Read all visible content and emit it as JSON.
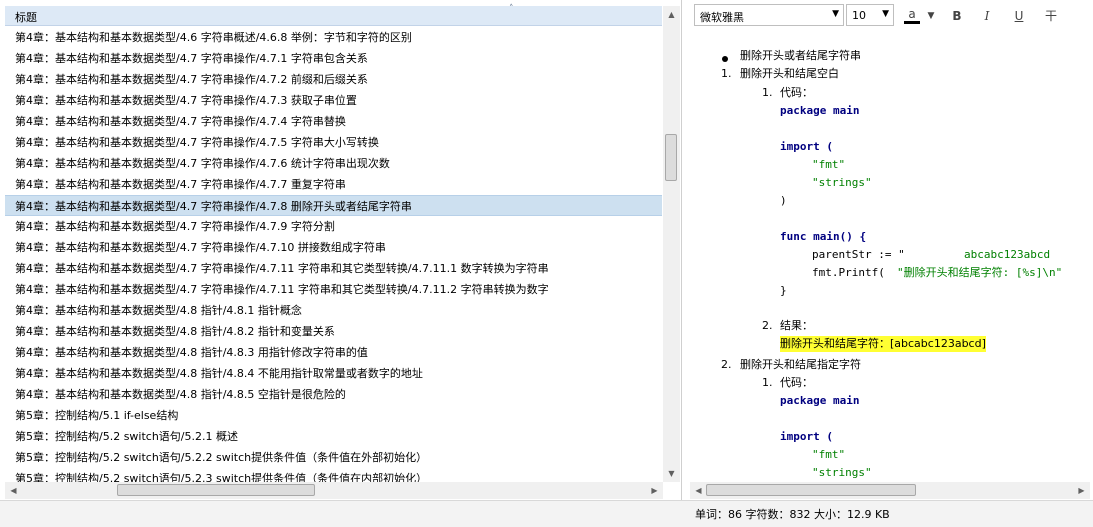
{
  "list": {
    "column_header": "标题",
    "rows": [
      "第4章：基本结构和基本数据类型/4.6 字符串概述/4.6.8 举例：字节和字符的区别",
      "第4章：基本结构和基本数据类型/4.7 字符串操作/4.7.1  字符串包含关系",
      "第4章：基本结构和基本数据类型/4.7 字符串操作/4.7.2  前缀和后缀关系",
      "第4章：基本结构和基本数据类型/4.7 字符串操作/4.7.3  获取子串位置",
      "第4章：基本结构和基本数据类型/4.7 字符串操作/4.7.4  字符串替换",
      "第4章：基本结构和基本数据类型/4.7 字符串操作/4.7.5  字符串大小写转换",
      "第4章：基本结构和基本数据类型/4.7 字符串操作/4.7.6  统计字符串出现次数",
      "第4章：基本结构和基本数据类型/4.7 字符串操作/4.7.7  重复字符串",
      "第4章：基本结构和基本数据类型/4.7 字符串操作/4.7.8  删除开头或者结尾字符串",
      "第4章：基本结构和基本数据类型/4.7 字符串操作/4.7.9  字符分割",
      "第4章：基本结构和基本数据类型/4.7 字符串操作/4.7.10  拼接数组成字符串",
      "第4章：基本结构和基本数据类型/4.7 字符串操作/4.7.11  字符串和其它类型转换/4.7.11.1  数字转换为字符串",
      "第4章：基本结构和基本数据类型/4.7 字符串操作/4.7.11  字符串和其它类型转换/4.7.11.2  字符串转换为数字",
      "第4章：基本结构和基本数据类型/4.8 指针/4.8.1 指针概念",
      "第4章：基本结构和基本数据类型/4.8 指针/4.8.2 指针和变量关系",
      "第4章：基本结构和基本数据类型/4.8 指针/4.8.3 用指针修改字符串的值",
      "第4章：基本结构和基本数据类型/4.8 指针/4.8.4 不能用指针取常量或者数字的地址",
      "第4章：基本结构和基本数据类型/4.8 指针/4.8.5 空指针是很危险的",
      "第5章：控制结构/5.1 if-else结构",
      "第5章：控制结构/5.2 switch语句/5.2.1 概述",
      "第5章：控制结构/5.2 switch语句/5.2.2 switch提供条件值（条件值在外部初始化）",
      "第5章：控制结构/5.2 switch语句/5.2.3 switch提供条件值（条件值在内部初始化）"
    ],
    "selected_index": 8
  },
  "toolbar": {
    "font_family": "微软雅黑",
    "font_size": "10",
    "font_color_glyph": "a",
    "bold": "B",
    "italic": "I",
    "underline": "U",
    "strike": "干"
  },
  "editor": {
    "bullet_item": "删除开头或者结尾字符串",
    "item1_title": "删除开头和结尾空白",
    "item1_code_label": "代码：",
    "item1_code": {
      "l1": "package main",
      "l2": "import (",
      "l3": "\"fmt\"",
      "l4": "\"strings\"",
      "l5": ")",
      "l6": "func main() {",
      "l7a": "parentStr := \"",
      "l7b": "abcabc123abcd",
      "l8a": "fmt.Printf(",
      "l8b": "\"删除开头和结尾字符: [%s]\\n\"",
      "l9": "}"
    },
    "item1_result_label": "结果：",
    "item1_result": "删除开头和结尾字符：[abcabc123abcd]",
    "item2_title": "删除开头和结尾指定字符",
    "item2_code_label": "代码：",
    "item2_code": {
      "l1": "package main",
      "l2": "import (",
      "l3": "\"fmt\"",
      "l4": "\"strings\""
    }
  },
  "status": {
    "text": "单词：86   字符数：832   大小：12.9 KB"
  }
}
